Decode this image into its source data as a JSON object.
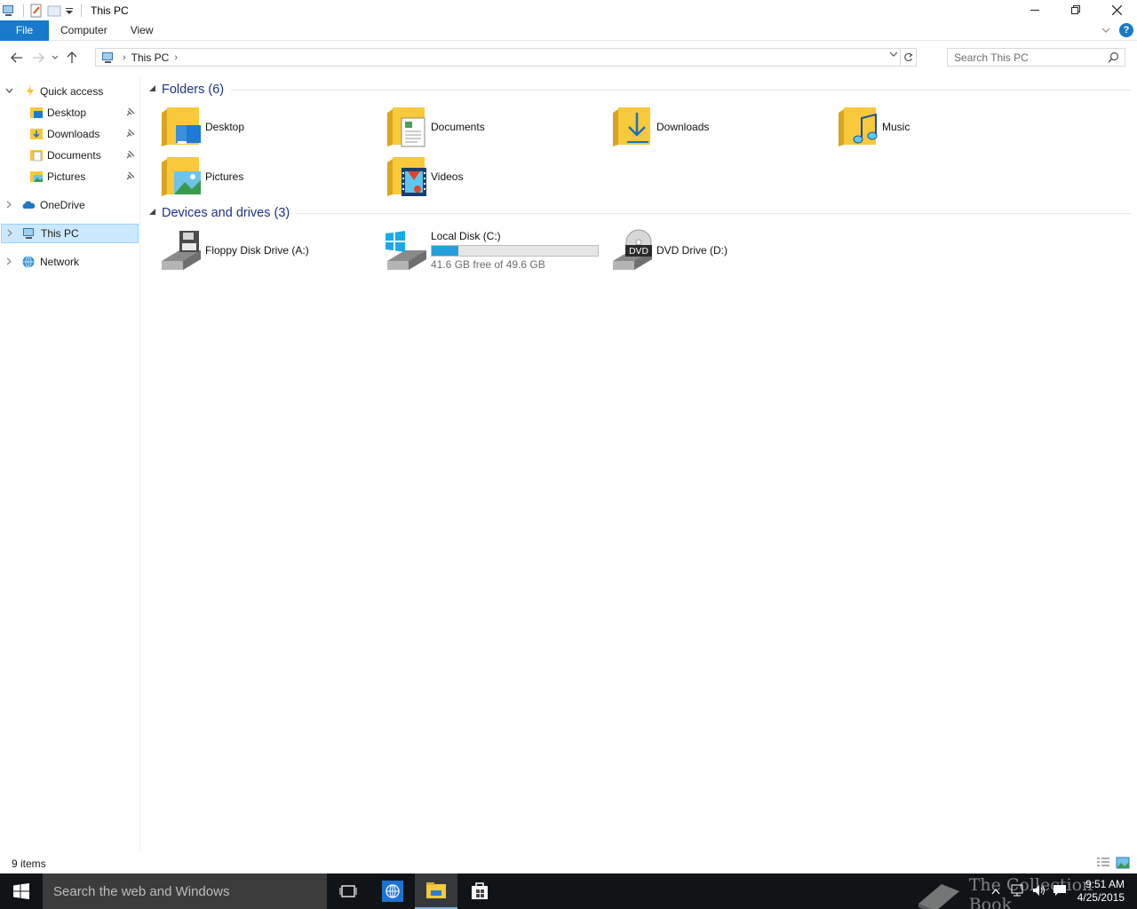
{
  "window": {
    "title": "This PC"
  },
  "ribbon": {
    "file_tab": "File",
    "tabs": [
      "Computer",
      "View"
    ]
  },
  "address": {
    "crumbs": [
      "This PC"
    ],
    "search_placeholder": "Search This PC"
  },
  "navpane": {
    "quick_access": "Quick access",
    "quick_items": [
      "Desktop",
      "Downloads",
      "Documents",
      "Pictures"
    ],
    "onedrive": "OneDrive",
    "this_pc": "This PC",
    "network": "Network"
  },
  "folders": {
    "header": "Folders (6)",
    "items": [
      "Desktop",
      "Documents",
      "Downloads",
      "Music",
      "Pictures",
      "Videos"
    ]
  },
  "devices": {
    "header": "Devices and drives (3)",
    "floppy": "Floppy Disk Drive (A:)",
    "local_disk": {
      "name": "Local Disk (C:)",
      "free_text": "41.6 GB free of 49.6 GB",
      "used_fraction": 0.161
    },
    "dvd": "DVD Drive (D:)",
    "dvd_badge": "DVD"
  },
  "status": {
    "items_text": "9 items"
  },
  "taskbar": {
    "search_placeholder": "Search the web and Windows",
    "time": "9:51 AM",
    "date": "4/25/2015",
    "watermark": "The Collection Book"
  },
  "colors": {
    "accent": "#1979ca",
    "selection": "#cce8ff",
    "folder": "#f8c93b",
    "drive_bar": "#26a0da"
  }
}
